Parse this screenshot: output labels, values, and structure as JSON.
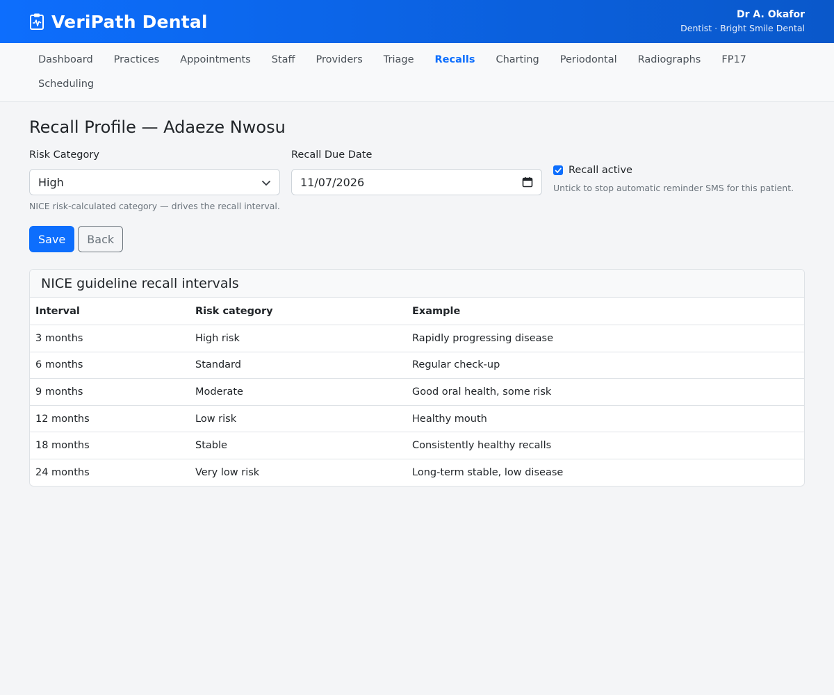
{
  "header": {
    "brand": "VeriPath Dental",
    "brand_icon": "clipboard-pulse-icon",
    "user_name": "Dr A. Okafor",
    "user_role": "Dentist · Bright Smile Dental"
  },
  "nav": {
    "items": [
      {
        "label": "Dashboard"
      },
      {
        "label": "Practices"
      },
      {
        "label": "Appointments"
      },
      {
        "label": "Staff"
      },
      {
        "label": "Providers"
      },
      {
        "label": "Triage"
      },
      {
        "label": "Recalls"
      },
      {
        "label": "Charting"
      },
      {
        "label": "Periodontal"
      },
      {
        "label": "Radiographs"
      },
      {
        "label": "FP17"
      },
      {
        "label": "Scheduling"
      }
    ],
    "active": "Recalls"
  },
  "page": {
    "title": "Recall Profile — Adaeze Nwosu"
  },
  "form": {
    "risk_label": "Risk Category",
    "risk_value": "High",
    "risk_help": "NICE risk-calculated category — drives the recall interval.",
    "due_label": "Recall Due Date",
    "due_value": "11/07/2026",
    "active_label": "Recall active",
    "active_checked": true,
    "active_help": "Untick to stop automatic reminder SMS for this patient.",
    "save_label": "Save",
    "back_label": "Back"
  },
  "intervals": {
    "title": "NICE guideline recall intervals",
    "columns": [
      "Interval",
      "Risk category",
      "Example"
    ],
    "rows": [
      [
        "3 months",
        "High risk",
        "Rapidly progressing disease"
      ],
      [
        "6 months",
        "Standard",
        "Regular check-up"
      ],
      [
        "9 months",
        "Moderate",
        "Good oral health, some risk"
      ],
      [
        "12 months",
        "Low risk",
        "Healthy mouth"
      ],
      [
        "18 months",
        "Stable",
        "Consistently healthy recalls"
      ],
      [
        "24 months",
        "Very low risk",
        "Long-term stable, low disease"
      ]
    ]
  },
  "colors": {
    "accent": "#0d6efd",
    "header_gradient_end": "#0a58ca",
    "page_bg": "#f4f5f7"
  }
}
